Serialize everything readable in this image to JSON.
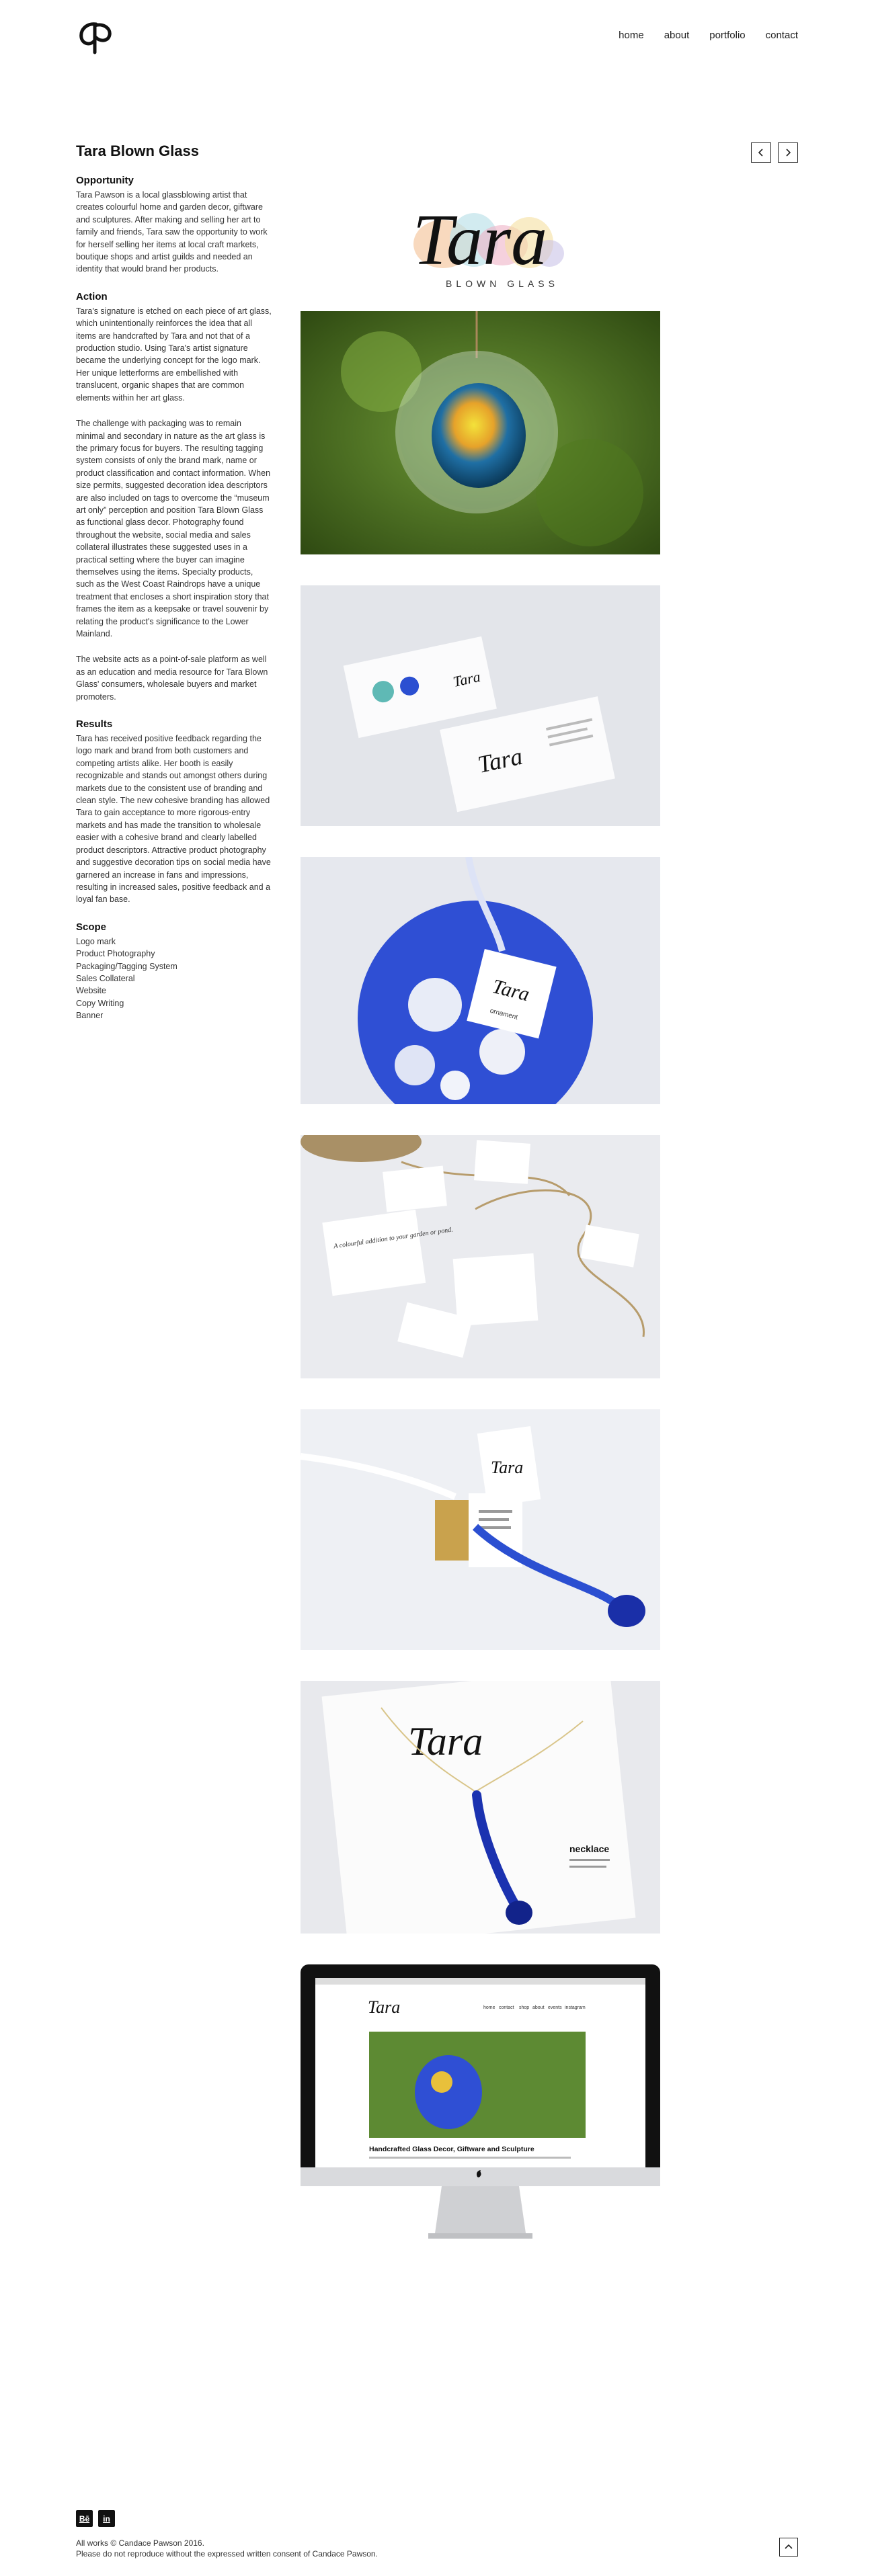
{
  "nav": {
    "items": [
      "home",
      "about",
      "portfolio",
      "contact"
    ]
  },
  "project": {
    "title": "Tara Blown Glass",
    "sections": [
      {
        "heading": "Opportunity",
        "paragraphs": [
          "Tara Pawson is a local glassblowing artist that creates colourful home and garden decor, giftware and sculptures. After making and selling her art to family and friends, Tara saw the opportunity to work for herself selling her items at local craft markets, boutique shops and artist guilds and needed an identity that would brand her products."
        ]
      },
      {
        "heading": "Action",
        "paragraphs": [
          "Tara's signature is etched on each piece of art glass, which unintentionally reinforces the idea that all items are handcrafted by Tara and not that of a production studio. Using Tara's artist signature became the underlying concept for the logo mark. Her unique letterforms are embellished with translucent, organic shapes that are common elements within her art glass.",
          "The challenge with packaging was to remain minimal and secondary in nature as the art glass is the primary focus for buyers. The resulting tagging system consists of only the brand mark, name or product classification and contact information. When size permits, suggested decoration idea descriptors are also included on tags to overcome the “museum art only” perception and position Tara Blown Glass as functional glass decor. Photography found throughout the website, social media and sales collateral illustrates these suggested uses in a practical setting where the buyer can imagine themselves using the items. Specialty products, such as the West Coast Raindrops have a unique treatment that encloses a short inspiration story that frames the item as a keepsake or travel souvenir by relating the product's significance to the Lower Mainland.",
          "The website acts as a point-of-sale platform as well as an education and media resource for Tara Blown Glass' consumers, wholesale buyers and market promoters."
        ]
      },
      {
        "heading": "Results",
        "paragraphs": [
          "Tara has received positive feedback regarding the logo mark and brand from both customers and competing artists alike. Her booth is easily recognizable and stands out amongst others during markets due to the consistent use of branding and clean style. The new cohesive branding has allowed Tara to gain acceptance to more rigorous-entry markets and has made the transition to wholesale easier with a cohesive brand and clearly labelled product descriptors. Attractive product photography and suggestive decoration tips on social media have garnered an increase in fans and impressions, resulting in increased sales, positive feedback and a loyal fan base."
        ]
      }
    ],
    "scope_heading": "Scope",
    "scope": [
      "Logo mark",
      "Product Photography",
      "Packaging/Tagging System",
      "Sales Collateral",
      "Website",
      "Copy Writing",
      "Banner"
    ]
  },
  "brand": {
    "logo_word": "Tara",
    "logo_sub": "BLOWN GLASS"
  },
  "gallery": {
    "tags": {
      "raindrops": "A colourful addition to your garden or pond.",
      "necklace": "necklace",
      "ornament": "ornament"
    },
    "website": {
      "headline": "Handcrafted Glass Decor, Giftware and Sculpture",
      "nav": [
        "home",
        "contact",
        "shop",
        "about",
        "events",
        "instagram"
      ]
    }
  },
  "footer": {
    "social": [
      "Bē",
      "in"
    ],
    "copyright_1": "All works © Candace Pawson 2016.",
    "copyright_2": "Please do not reproduce without the expressed written consent of Candace Pawson."
  },
  "colors": {
    "accent": "#111111",
    "blue_glass": "#1f3fc8",
    "green_bg": "#5f8a2e"
  }
}
